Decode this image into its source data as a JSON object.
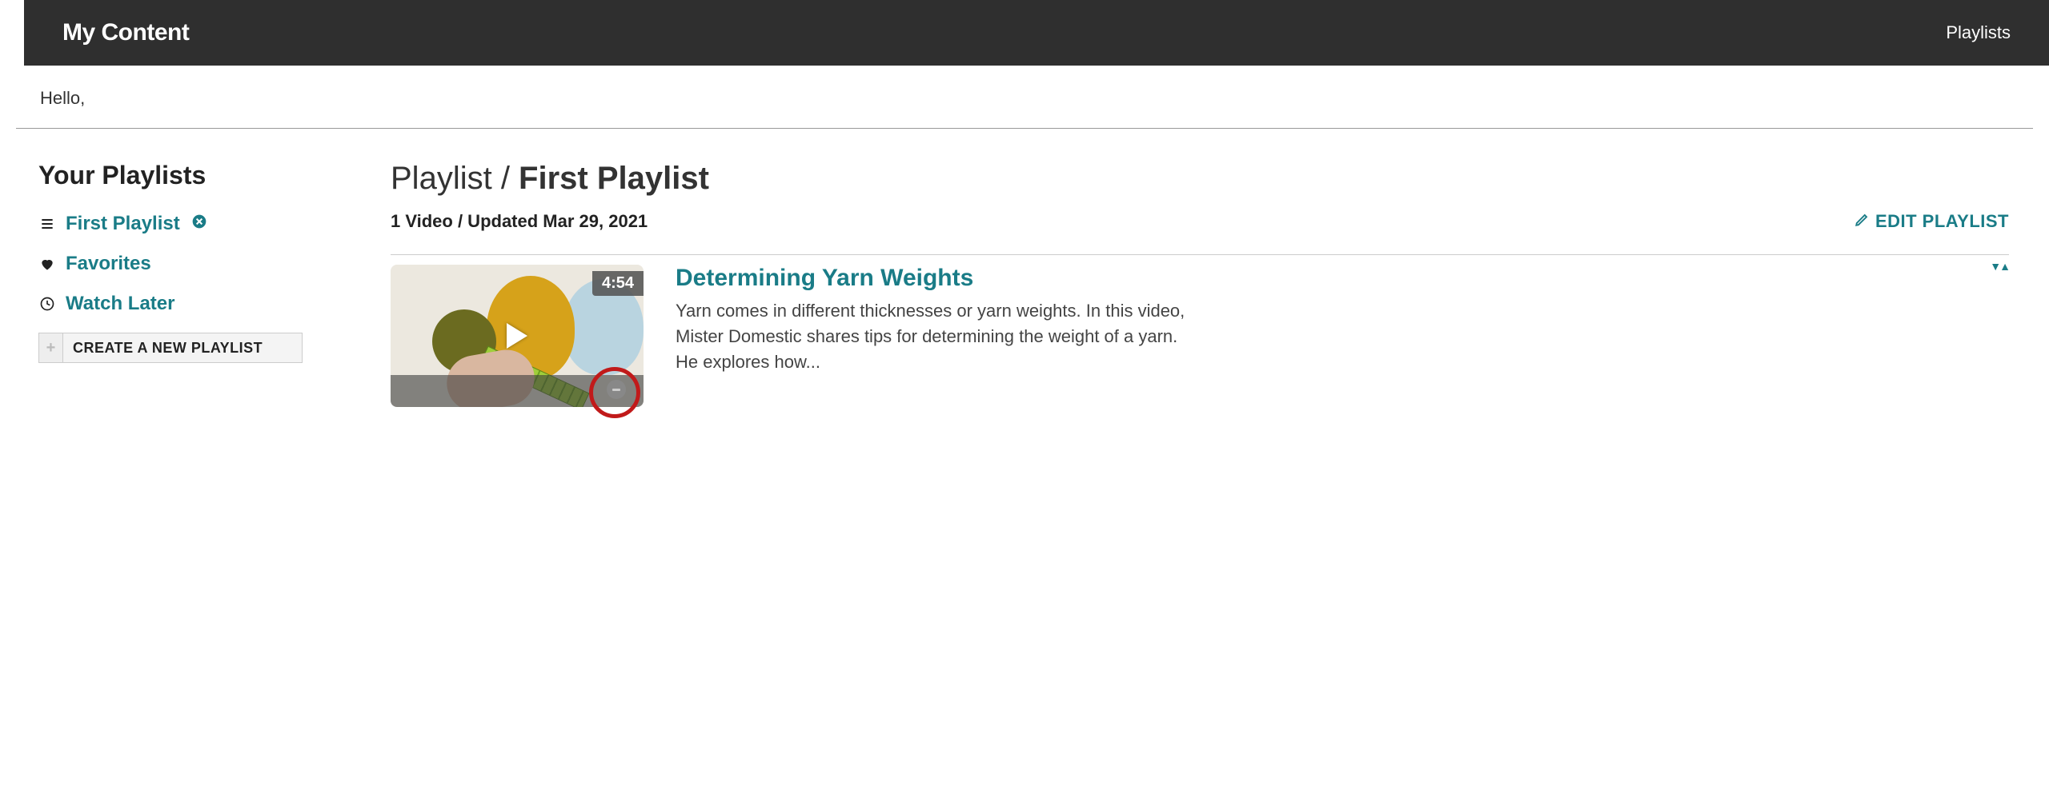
{
  "topbar": {
    "title": "My Content",
    "nav_playlists": "Playlists"
  },
  "greeting": "Hello,",
  "sidebar": {
    "heading": "Your Playlists",
    "items": [
      {
        "label": "First Playlist",
        "icon": "list-icon",
        "has_delete": true
      },
      {
        "label": "Favorites",
        "icon": "heart-icon",
        "has_delete": false
      },
      {
        "label": "Watch Later",
        "icon": "clock-icon",
        "has_delete": false
      }
    ],
    "create_label": "CREATE A NEW PLAYLIST"
  },
  "content": {
    "breadcrumb_prefix": "Playlist / ",
    "breadcrumb_name": "First Playlist",
    "meta": "1 Video / Updated Mar 29, 2021",
    "edit_label": "EDIT PLAYLIST",
    "videos": [
      {
        "duration": "4:54",
        "title": "Determining Yarn Weights",
        "description": "Yarn comes in different thicknesses or yarn weights. In this video, Mister Domestic shares tips for determining the weight of a yarn. He explores how..."
      }
    ]
  }
}
